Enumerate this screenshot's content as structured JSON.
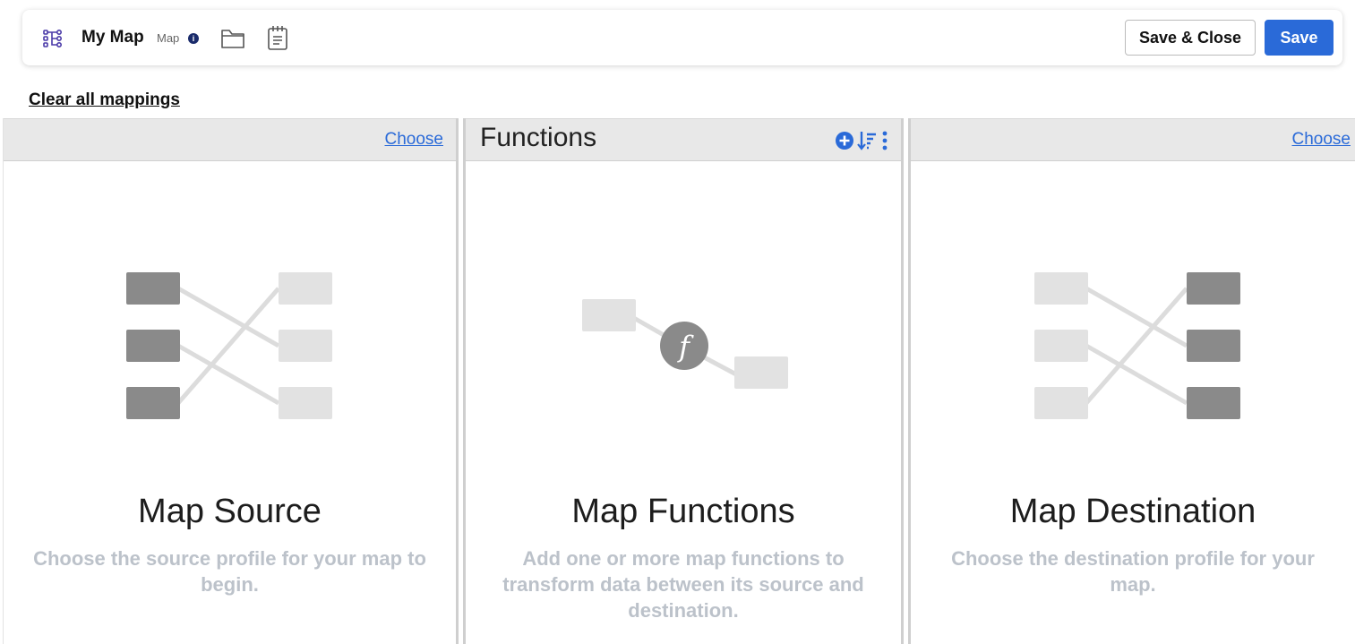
{
  "header": {
    "title": "My Map",
    "type_label": "Map",
    "save_close_label": "Save & Close",
    "save_label": "Save"
  },
  "clear_link": "Clear all mappings",
  "source": {
    "choose_label": "Choose",
    "heading": "Map Source",
    "description": "Choose the source profile for your map to begin."
  },
  "functions": {
    "title": "Functions",
    "heading": "Map Functions",
    "description": "Add one or more map functions to transform data between its source and destination.",
    "glyph": "f"
  },
  "destination": {
    "choose_label": "Choose",
    "heading": "Map Destination",
    "description": "Choose the destination profile for your map."
  },
  "colors": {
    "accent": "#2a6ad8",
    "brand_icon": "#4a3aa8",
    "muted_text": "#bcc2ca"
  },
  "icons": [
    "map-icon",
    "info-icon",
    "folder-icon",
    "notes-icon",
    "add-function-icon",
    "sort-icon",
    "more-options-icon"
  ]
}
